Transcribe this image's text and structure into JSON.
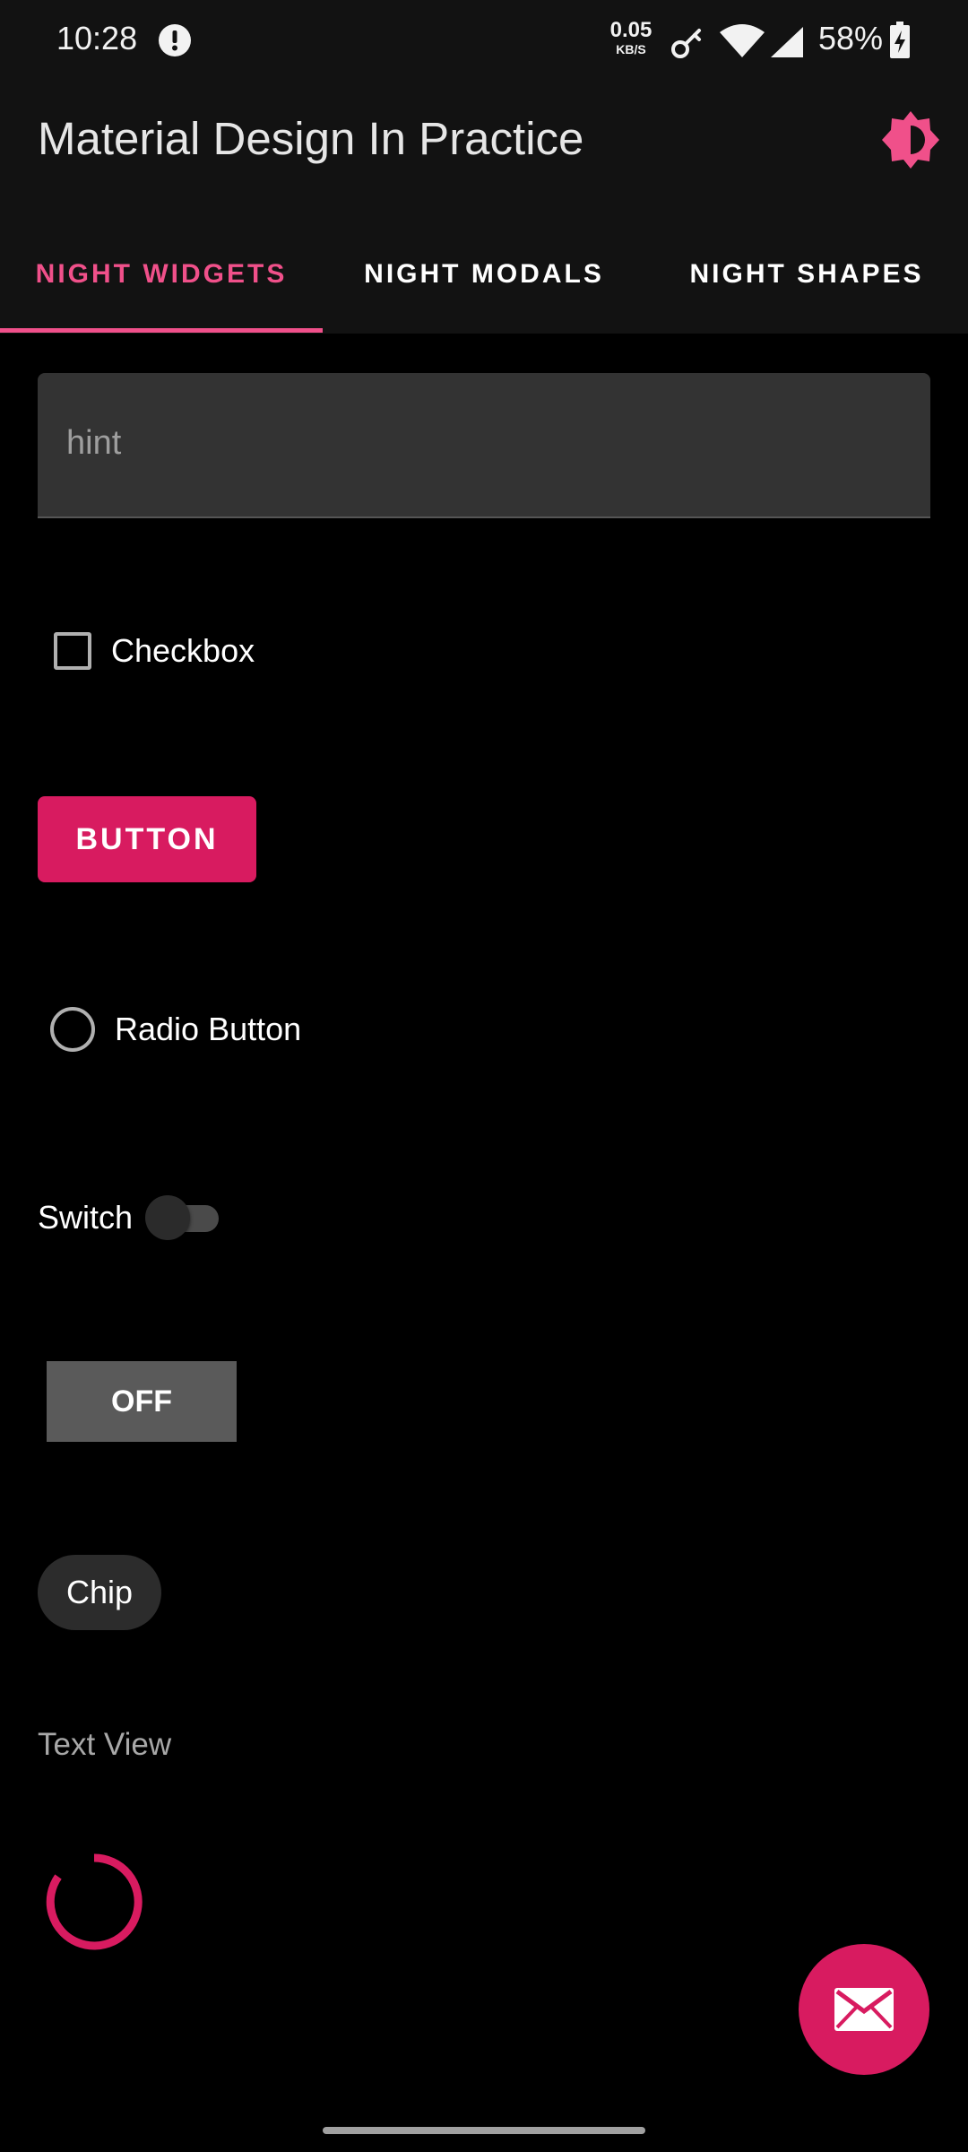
{
  "status_bar": {
    "time": "10:28",
    "net_speed_value": "0.05",
    "net_speed_unit": "KB/S",
    "battery": "58%"
  },
  "app_bar": {
    "title": "Material Design In Practice",
    "theme_icon": "brightness-icon"
  },
  "tabs": [
    {
      "label": "NIGHT WIDGETS",
      "active": true
    },
    {
      "label": "NIGHT MODALS",
      "active": false
    },
    {
      "label": "NIGHT SHAPES",
      "active": false
    }
  ],
  "content": {
    "text_field_placeholder": "hint",
    "checkbox_label": "Checkbox",
    "checkbox_checked": false,
    "button_label": "BUTTON",
    "radio_label": "Radio Button",
    "radio_selected": false,
    "switch_label": "Switch",
    "switch_on": false,
    "toggle_label": "OFF",
    "chip_label": "Chip",
    "text_view": "Text View"
  },
  "fab": {
    "icon": "mail-icon"
  },
  "colors": {
    "accent": "#d81b60",
    "accent_light": "#f0508a",
    "bar_background": "#121212",
    "background": "#000000"
  }
}
